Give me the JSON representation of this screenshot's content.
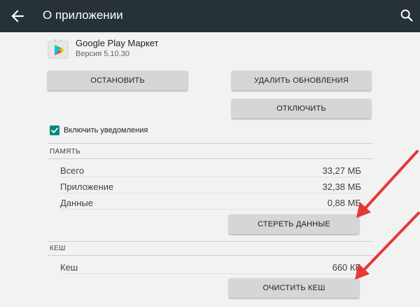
{
  "appbar": {
    "title": "О приложении"
  },
  "app": {
    "name": "Google Play Маркет",
    "version": "Версия 5.10.30"
  },
  "buttons": {
    "stop": "ОСТАНОВИТЬ",
    "uninstall_updates": "УДАЛИТЬ ОБНОВЛЕНИЯ",
    "disable": "ОТКЛЮЧИТЬ",
    "clear_data": "СТЕРЕТЬ ДАННЫЕ",
    "clear_cache": "ОЧИСТИТЬ КЕШ"
  },
  "notifications": {
    "label": "Включить уведомления",
    "checked": true
  },
  "storage": {
    "header": "ПАМЯТЬ",
    "rows": [
      {
        "label": "Всего",
        "value": "33,27 МБ"
      },
      {
        "label": "Приложение",
        "value": "32,38 МБ"
      },
      {
        "label": "Данные",
        "value": "0,88 МБ"
      }
    ]
  },
  "cache": {
    "header": "КЕШ",
    "rows": [
      {
        "label": "Кеш",
        "value": "660 КБ"
      }
    ]
  },
  "colors": {
    "appbar": "#263238",
    "checkbox": "#00897b",
    "annotation_arrow": "#e53935"
  },
  "icons": [
    "back-arrow-icon",
    "search-icon",
    "google-play-icon",
    "checkmark-icon"
  ]
}
